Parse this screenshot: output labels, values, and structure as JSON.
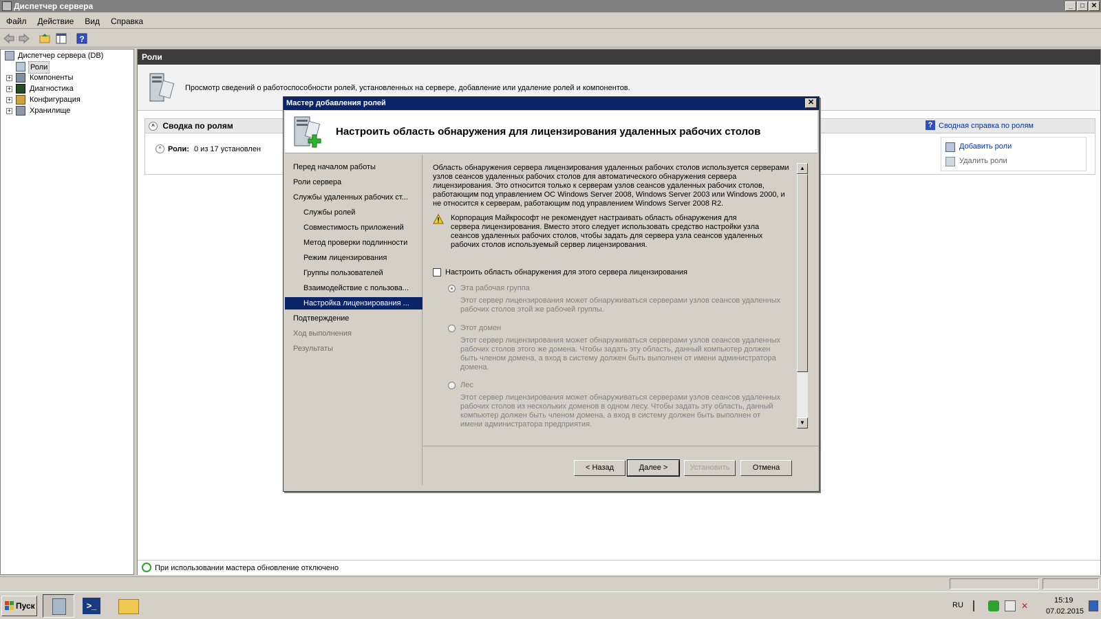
{
  "window": {
    "title": "Диспетчер сервера",
    "buttons": {
      "minimize": "_",
      "maximize": "□",
      "close": "✕"
    }
  },
  "menu": [
    "Файл",
    "Действие",
    "Вид",
    "Справка"
  ],
  "tree": {
    "root": "Диспетчер сервера (DB)",
    "items": [
      {
        "label": "Роли",
        "selected": true
      },
      {
        "label": "Компоненты"
      },
      {
        "label": "Диагностика"
      },
      {
        "label": "Конфигурация"
      },
      {
        "label": "Хранилище"
      }
    ]
  },
  "pane": {
    "header": "Роли",
    "intro": "Просмотр сведений о работоспособности ролей, установленных на сервере, добавление или удаление ролей и компонентов.",
    "summary_title": "Сводка по ролям",
    "summary_help": "Сводная справка по ролям",
    "roles_label": "Роли:",
    "roles_value": "0 из 17 установлен",
    "actions": {
      "add": "Добавить роли",
      "remove": "Удалить роли"
    }
  },
  "dialog": {
    "title": "Мастер добавления ролей",
    "close": "✕",
    "heading": "Настроить область обнаружения для лицензирования удаленных рабочих столов",
    "nav": [
      {
        "label": "Перед началом работы",
        "level": 0
      },
      {
        "label": "Роли сервера",
        "level": 0
      },
      {
        "label": "Службы удаленных рабочих ст...",
        "level": 0
      },
      {
        "label": "Службы ролей",
        "level": 1
      },
      {
        "label": "Совместимость приложений",
        "level": 1
      },
      {
        "label": "Метод проверки подлинности",
        "level": 1
      },
      {
        "label": "Режим лицензирования",
        "level": 1
      },
      {
        "label": "Группы пользователей",
        "level": 1
      },
      {
        "label": "Взаимодействие с пользова...",
        "level": 1
      },
      {
        "label": "Настройка лицензирования ...",
        "level": 1,
        "selected": true
      },
      {
        "label": "Подтверждение",
        "level": 0
      },
      {
        "label": "Ход выполнения",
        "level": 0,
        "disabled": true
      },
      {
        "label": "Результаты",
        "level": 0,
        "disabled": true
      }
    ],
    "description": "Область обнаружения сервера лицензирования удаленных рабочих столов используется серверами узлов сеансов удаленных рабочих столов для автоматического обнаружения сервера лицензирования. Это относится только к серверам узлов сеансов удаленных рабочих столов, работающим под управлением ОС Windows Server 2008, Windows Server 2003 или Windows 2000, и не относится к серверам, работающим под управлением Windows Server 2008 R2.",
    "warning": "Корпорация Майкрософт не рекомендует настраивать область обнаружения для сервера лицензирования. Вместо этого следует использовать средство настройки узла сеансов удаленных рабочих столов, чтобы задать для сервера узла сеансов удаленных рабочих столов используемый сервер лицензирования.",
    "checkbox": {
      "label": "Настроить область обнаружения для этого сервера лицензирования",
      "checked": false
    },
    "options": [
      {
        "label": "Эта рабочая группа",
        "checked": true,
        "desc": "Этот сервер лицензирования может обнаруживаться серверами узлов сеансов удаленных рабочих столов этой же рабочей группы."
      },
      {
        "label": "Этот домен",
        "checked": false,
        "desc": "Этот сервер лицензирования может обнаруживаться серверами узлов сеансов удаленных рабочих столов этого же домена. Чтобы задать эту область, данный компьютер должен быть членом домена, а вход в систему должен быть выполнен от имени администратора домена."
      },
      {
        "label": "Лес",
        "checked": false,
        "desc": "Этот сервер лицензирования может обнаруживаться серверами узлов сеансов удаленных рабочих столов из нескольких доменов в одном лесу. Чтобы задать эту область, данный компьютер должен быть членом домена, а вход в систему должен быть выполнен от имени администратора предприятия."
      }
    ],
    "buttons": {
      "back": "< Назад",
      "next": "Далее >",
      "install": "Установить",
      "cancel": "Отмена"
    }
  },
  "statusbar": {
    "message": "При использовании мастера обновление отключено"
  },
  "taskbar": {
    "start": "Пуск",
    "lang": "RU",
    "time": "15:19",
    "date": "07.02.2015"
  },
  "colors": {
    "title_active": "#0a246a",
    "pane_header": "#3c3c3c",
    "window_bg": "#d4d0c8",
    "link": "#0033aa"
  }
}
